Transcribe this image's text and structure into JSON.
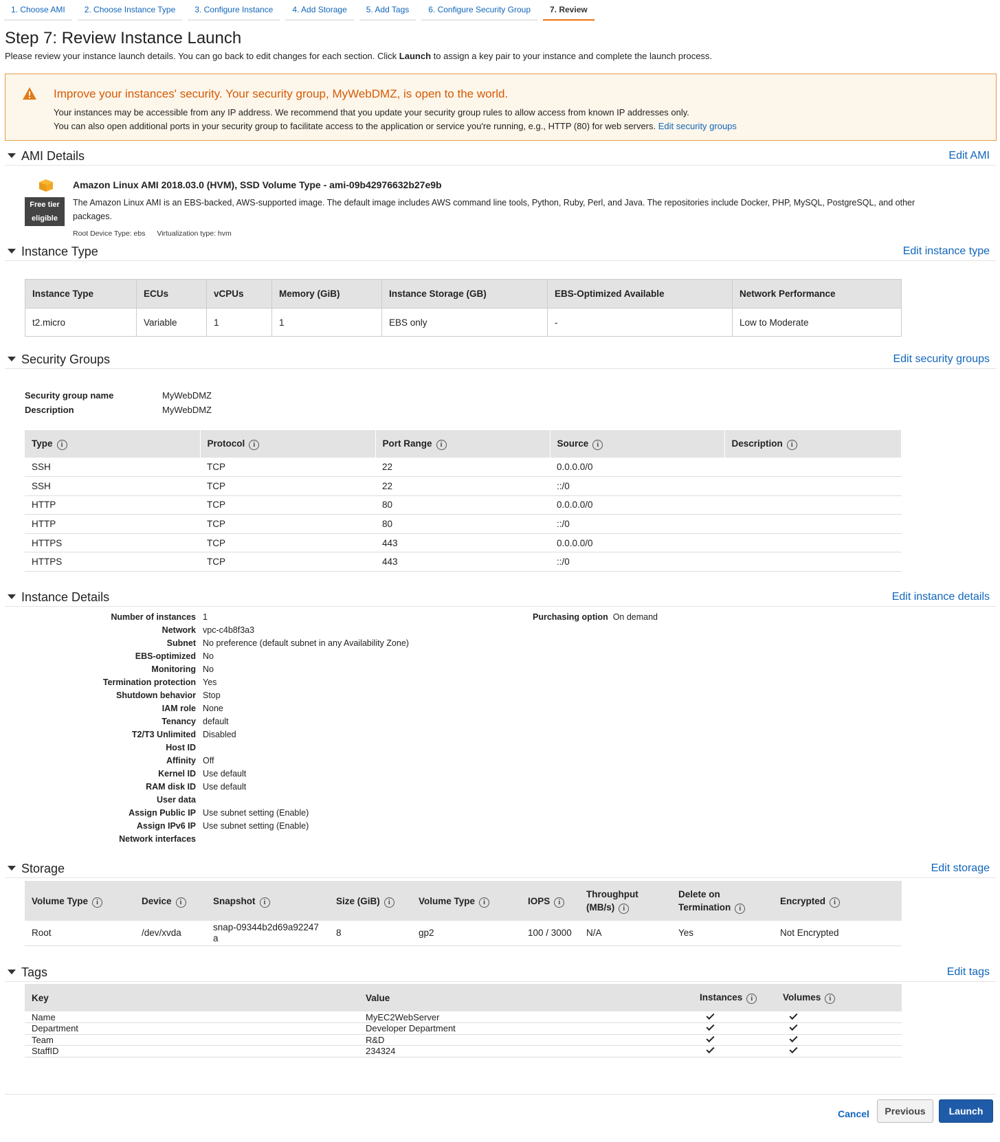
{
  "tabs": [
    {
      "label": "1. Choose AMI"
    },
    {
      "label": "2. Choose Instance Type"
    },
    {
      "label": "3. Configure Instance"
    },
    {
      "label": "4. Add Storage"
    },
    {
      "label": "5. Add Tags"
    },
    {
      "label": "6. Configure Security Group"
    },
    {
      "label": "7. Review"
    }
  ],
  "page": {
    "title": "Step 7: Review Instance Launch",
    "intro_before": "Please review your instance launch details. You can go back to edit changes for each section. Click ",
    "intro_bold": "Launch",
    "intro_after": " to assign a key pair to your instance and complete the launch process."
  },
  "warning": {
    "title": "Improve your instances' security. Your security group, MyWebDMZ, is open to the world.",
    "line1": "Your instances may be accessible from any IP address. We recommend that you update your security group rules to allow access from known IP addresses only.",
    "line2": "You can also open additional ports in your security group to facilitate access to the application or service you're running, e.g., HTTP (80) for web servers.",
    "link": "Edit security groups"
  },
  "ami": {
    "section": "AMI Details",
    "edit": "Edit AMI",
    "badge_line1": "Free tier",
    "badge_line2": "eligible",
    "name": "Amazon Linux AMI 2018.03.0 (HVM), SSD Volume Type - ami-09b42976632b27e9b",
    "description": "The Amazon Linux AMI is an EBS-backed, AWS-supported image. The default image includes AWS command line tools, Python, Ruby, Perl, and Java. The repositories include Docker, PHP, MySQL, PostgreSQL, and other packages.",
    "root_device": "Root Device Type: ebs",
    "virtualization": "Virtualization type: hvm"
  },
  "instance_type": {
    "section": "Instance Type",
    "edit": "Edit instance type",
    "headers": [
      "Instance Type",
      "ECUs",
      "vCPUs",
      "Memory (GiB)",
      "Instance Storage (GB)",
      "EBS-Optimized Available",
      "Network Performance"
    ],
    "row": [
      "t2.micro",
      "Variable",
      "1",
      "1",
      "EBS only",
      "-",
      "Low to Moderate"
    ]
  },
  "security_groups": {
    "section": "Security Groups",
    "edit": "Edit security groups",
    "name_label": "Security group name",
    "name_value": "MyWebDMZ",
    "desc_label": "Description",
    "desc_value": "MyWebDMZ",
    "headers": [
      "Type",
      "Protocol",
      "Port Range",
      "Source",
      "Description"
    ],
    "rows": [
      [
        "SSH",
        "TCP",
        "22",
        "0.0.0.0/0",
        ""
      ],
      [
        "SSH",
        "TCP",
        "22",
        "::/0",
        ""
      ],
      [
        "HTTP",
        "TCP",
        "80",
        "0.0.0.0/0",
        ""
      ],
      [
        "HTTP",
        "TCP",
        "80",
        "::/0",
        ""
      ],
      [
        "HTTPS",
        "TCP",
        "443",
        "0.0.0.0/0",
        ""
      ],
      [
        "HTTPS",
        "TCP",
        "443",
        "::/0",
        ""
      ]
    ]
  },
  "instance_details": {
    "section": "Instance Details",
    "edit": "Edit instance details",
    "items": [
      {
        "k": "Number of instances",
        "v": "1"
      },
      {
        "k": "Network",
        "v": "vpc-c4b8f3a3"
      },
      {
        "k": "Subnet",
        "v": "No preference (default subnet in any Availability Zone)"
      },
      {
        "k": "EBS-optimized",
        "v": "No"
      },
      {
        "k": "Monitoring",
        "v": "No"
      },
      {
        "k": "Termination protection",
        "v": "Yes"
      },
      {
        "k": "Shutdown behavior",
        "v": "Stop"
      },
      {
        "k": "IAM role",
        "v": "None"
      },
      {
        "k": "Tenancy",
        "v": "default"
      },
      {
        "k": "T2/T3 Unlimited",
        "v": "Disabled"
      },
      {
        "k": "Host ID",
        "v": ""
      },
      {
        "k": "Affinity",
        "v": "Off"
      },
      {
        "k": "Kernel ID",
        "v": "Use default"
      },
      {
        "k": "RAM disk ID",
        "v": "Use default"
      },
      {
        "k": "User data",
        "v": ""
      },
      {
        "k": "Assign Public IP",
        "v": "Use subnet setting (Enable)"
      },
      {
        "k": "Assign IPv6 IP",
        "v": "Use subnet setting (Enable)"
      },
      {
        "k": "Network interfaces",
        "v": ""
      }
    ],
    "purchasing_label": "Purchasing option",
    "purchasing_value": "On demand"
  },
  "storage": {
    "section": "Storage",
    "edit": "Edit storage",
    "headers": [
      "Volume Type",
      "Device",
      "Snapshot",
      "Size (GiB)",
      "Volume Type",
      "IOPS",
      "Throughput (MB/s)",
      "Delete on Termination",
      "Encrypted"
    ],
    "row": [
      "Root",
      "/dev/xvda",
      "snap-09344b2d69a92247a",
      "8",
      "gp2",
      "100 / 3000",
      "N/A",
      "Yes",
      "Not Encrypted"
    ]
  },
  "tags": {
    "section": "Tags",
    "edit": "Edit tags",
    "headers": [
      "Key",
      "Value",
      "Instances",
      "Volumes"
    ],
    "rows": [
      {
        "key": "Name",
        "value": "MyEC2WebServer"
      },
      {
        "key": "Department",
        "value": "Developer Department"
      },
      {
        "key": "Team",
        "value": "R&D"
      },
      {
        "key": "StaffID",
        "value": "234324"
      }
    ]
  },
  "footer": {
    "cancel": "Cancel",
    "previous": "Previous",
    "launch": "Launch"
  },
  "colors": {
    "accent_orange": "#ec7211",
    "link_blue": "#1166bb",
    "launch_blue": "#1f5ba8",
    "warning_title": "#d45b07"
  }
}
